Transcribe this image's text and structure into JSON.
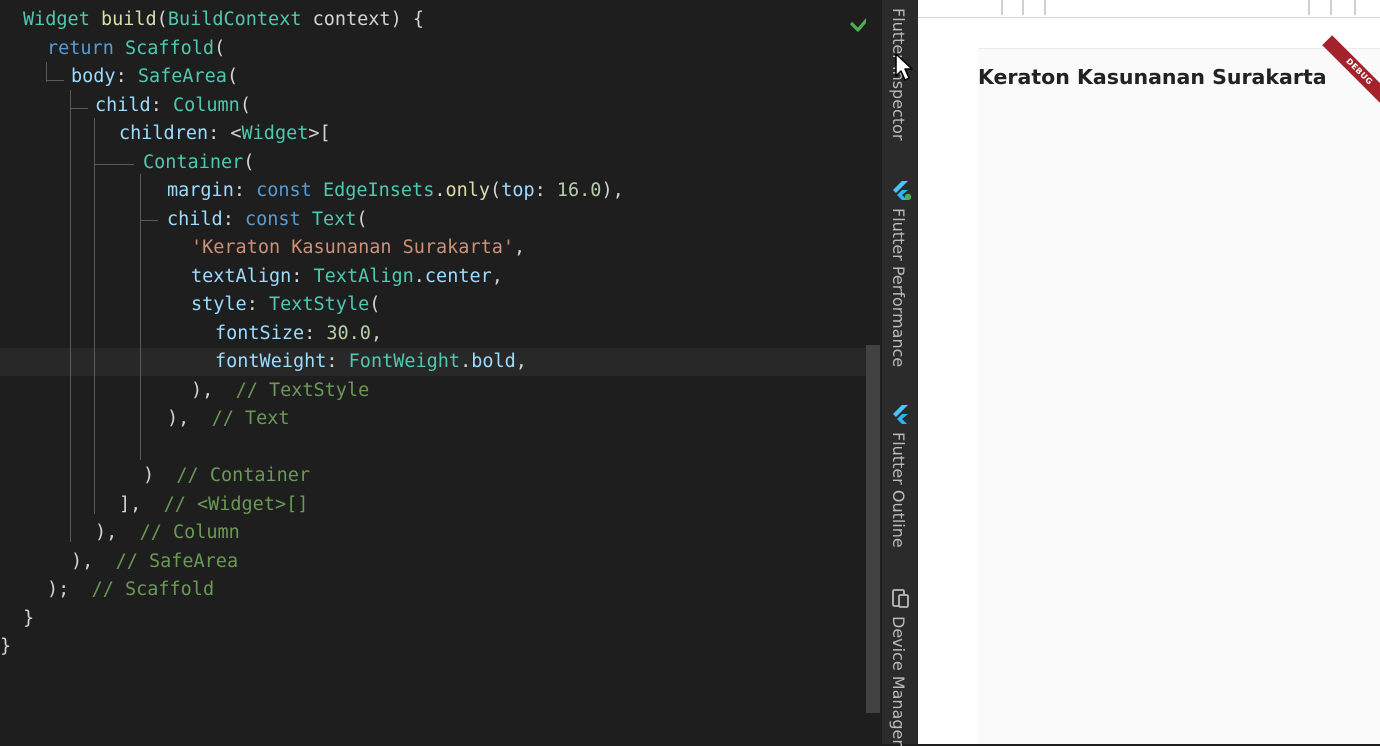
{
  "editor": {
    "lines": [
      [
        {
          "t": "Widget",
          "c": "ty"
        },
        {
          "t": " ",
          "c": "p"
        },
        {
          "t": "build",
          "c": "fn"
        },
        {
          "t": "(",
          "c": "p"
        },
        {
          "t": "BuildContext",
          "c": "ty"
        },
        {
          "t": " context) {",
          "c": "p"
        }
      ],
      [
        {
          "t": "return",
          "c": "kw"
        },
        {
          "t": " ",
          "c": "p"
        },
        {
          "t": "Scaffold",
          "c": "ty"
        },
        {
          "t": "(",
          "c": "p"
        }
      ],
      [
        {
          "t": "body",
          "c": "id"
        },
        {
          "t": ": ",
          "c": "p"
        },
        {
          "t": "SafeArea",
          "c": "ty"
        },
        {
          "t": "(",
          "c": "p"
        }
      ],
      [
        {
          "t": "child",
          "c": "id"
        },
        {
          "t": ": ",
          "c": "p"
        },
        {
          "t": "Column",
          "c": "ty"
        },
        {
          "t": "(",
          "c": "p"
        }
      ],
      [
        {
          "t": "children",
          "c": "id"
        },
        {
          "t": ": <",
          "c": "p"
        },
        {
          "t": "Widget",
          "c": "ty"
        },
        {
          "t": ">[",
          "c": "p"
        }
      ],
      [
        {
          "t": "Container",
          "c": "ty"
        },
        {
          "t": "(",
          "c": "p"
        }
      ],
      [
        {
          "t": "margin",
          "c": "id"
        },
        {
          "t": ": ",
          "c": "p"
        },
        {
          "t": "const",
          "c": "kw"
        },
        {
          "t": " ",
          "c": "p"
        },
        {
          "t": "EdgeInsets",
          "c": "ty"
        },
        {
          "t": ".",
          "c": "p"
        },
        {
          "t": "only",
          "c": "fn"
        },
        {
          "t": "(",
          "c": "p"
        },
        {
          "t": "top",
          "c": "id"
        },
        {
          "t": ": ",
          "c": "p"
        },
        {
          "t": "16.0",
          "c": "num"
        },
        {
          "t": "),",
          "c": "p"
        }
      ],
      [
        {
          "t": "child",
          "c": "id"
        },
        {
          "t": ": ",
          "c": "p"
        },
        {
          "t": "const",
          "c": "kw"
        },
        {
          "t": " ",
          "c": "p"
        },
        {
          "t": "Text",
          "c": "ty"
        },
        {
          "t": "(",
          "c": "p"
        }
      ],
      [
        {
          "t": "'Keraton Kasunanan Surakarta'",
          "c": "str"
        },
        {
          "t": ",",
          "c": "p"
        }
      ],
      [
        {
          "t": "textAlign",
          "c": "id"
        },
        {
          "t": ": ",
          "c": "p"
        },
        {
          "t": "TextAlign",
          "c": "ty"
        },
        {
          "t": ".",
          "c": "p"
        },
        {
          "t": "center",
          "c": "id"
        },
        {
          "t": ",",
          "c": "p"
        }
      ],
      [
        {
          "t": "style",
          "c": "id"
        },
        {
          "t": ": ",
          "c": "p"
        },
        {
          "t": "TextStyle",
          "c": "ty"
        },
        {
          "t": "(",
          "c": "p"
        }
      ],
      [
        {
          "t": "fontSize",
          "c": "id"
        },
        {
          "t": ": ",
          "c": "p"
        },
        {
          "t": "30.0",
          "c": "num"
        },
        {
          "t": ",",
          "c": "p"
        }
      ],
      [
        {
          "t": "fontWeight",
          "c": "id"
        },
        {
          "t": ": ",
          "c": "p"
        },
        {
          "t": "FontWeight",
          "c": "ty"
        },
        {
          "t": ".",
          "c": "p"
        },
        {
          "t": "bold",
          "c": "id"
        },
        {
          "t": ",",
          "c": "p"
        }
      ],
      [
        {
          "t": "),",
          "c": "p"
        },
        {
          "t": "  ",
          "c": "p"
        },
        {
          "t": "// TextStyle",
          "c": "cm"
        }
      ],
      [
        {
          "t": "),",
          "c": "p"
        },
        {
          "t": "  ",
          "c": "p"
        },
        {
          "t": "// Text",
          "c": "cm"
        }
      ],
      [],
      [
        {
          "t": ")",
          "c": "p"
        },
        {
          "t": "  ",
          "c": "p"
        },
        {
          "t": "// Container",
          "c": "cm"
        }
      ],
      [
        {
          "t": "],",
          "c": "p"
        },
        {
          "t": "  ",
          "c": "p"
        },
        {
          "t": "// <Widget>[]",
          "c": "cm"
        }
      ],
      [
        {
          "t": "),",
          "c": "p"
        },
        {
          "t": "  ",
          "c": "p"
        },
        {
          "t": "// Column",
          "c": "cm"
        }
      ],
      [
        {
          "t": "),",
          "c": "p"
        },
        {
          "t": "  ",
          "c": "p"
        },
        {
          "t": "// SafeArea",
          "c": "cm"
        }
      ],
      [
        {
          "t": ");",
          "c": "p"
        },
        {
          "t": "  ",
          "c": "p"
        },
        {
          "t": "// Scaffold",
          "c": "cm"
        }
      ],
      [
        {
          "t": "}",
          "c": "p"
        }
      ],
      [
        {
          "t": "}",
          "c": "p"
        }
      ]
    ],
    "colors": {
      "kw": "#569cd6",
      "ty": "#4ec9b0",
      "str": "#ce9178",
      "num": "#b5cea8",
      "cm": "#6a9955",
      "id": "#9cdcfe",
      "fn": "#dcdcaa",
      "p": "#d4d4d4"
    }
  },
  "sidebar": {
    "tabs": [
      {
        "label": "Flutter Inspector",
        "icon": "flutter-inspector-icon"
      },
      {
        "label": "Flutter Performance",
        "icon": "flutter-performance-icon"
      },
      {
        "label": "Flutter Outline",
        "icon": "flutter-outline-icon"
      },
      {
        "label": "Device Manager",
        "icon": "device-manager-icon"
      }
    ]
  },
  "preview": {
    "title": "Keraton Kasunanan Surakarta",
    "debug_banner": "DEBUG",
    "banner_color": "#a4222b"
  },
  "status": {
    "analysis_icon": "check-icon",
    "accent": "#4caf50"
  }
}
